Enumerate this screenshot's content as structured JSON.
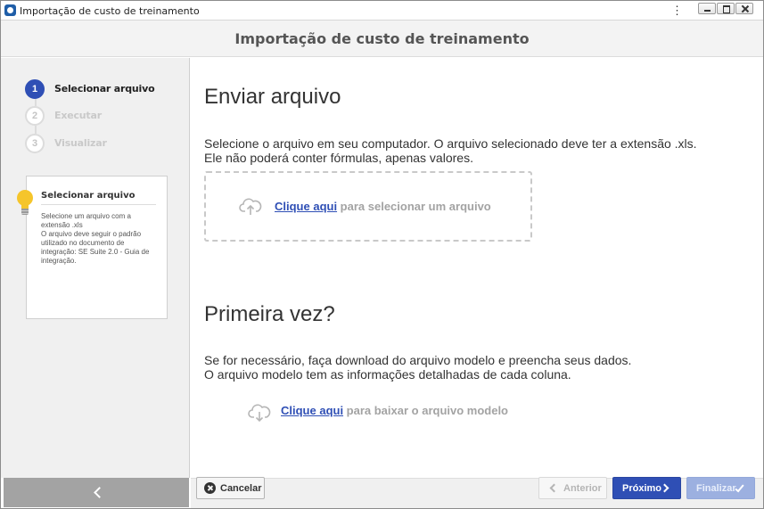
{
  "window": {
    "title": "Importação de custo de treinamento"
  },
  "header": {
    "title": "Importação de custo de treinamento"
  },
  "sidebar": {
    "steps": [
      {
        "number": "1",
        "label": "Selecionar arquivo",
        "state": "active"
      },
      {
        "number": "2",
        "label": "Executar",
        "state": "disabled"
      },
      {
        "number": "3",
        "label": "Visualizar",
        "state": "disabled"
      }
    ],
    "hint": {
      "title": "Selecionar arquivo",
      "text": "Selecione um arquivo com a extensão .xls\nO arquivo deve seguir o padrão utilizado no documento de integração: SE Suite 2.0 - Guia de integração."
    }
  },
  "main": {
    "send": {
      "heading": "Enviar arquivo",
      "description_line1": "Selecione o arquivo em seu computador. O arquivo selecionado deve ter a extensão .xls.",
      "description_line2": "Ele não poderá conter fórmulas, apenas valores.",
      "link_text": "Clique aqui",
      "link_suffix": " para selecionar um arquivo"
    },
    "first_time": {
      "heading": "Primeira vez?",
      "description_line1": "Se for necessário, faça download do arquivo modelo e preencha seus dados.",
      "description_line2": "O arquivo modelo tem as informações detalhadas de cada coluna.",
      "link_text": "Clique aqui",
      "link_suffix": " para baixar o arquivo modelo"
    }
  },
  "footer": {
    "cancel_label": "Cancelar",
    "previous_label": "Anterior",
    "next_label": "Próximo",
    "finish_label": "Finalizar"
  },
  "colors": {
    "accent": "#2f4fb5",
    "accent_disabled": "#9cb0e0",
    "muted_text": "#a3a3a3"
  }
}
